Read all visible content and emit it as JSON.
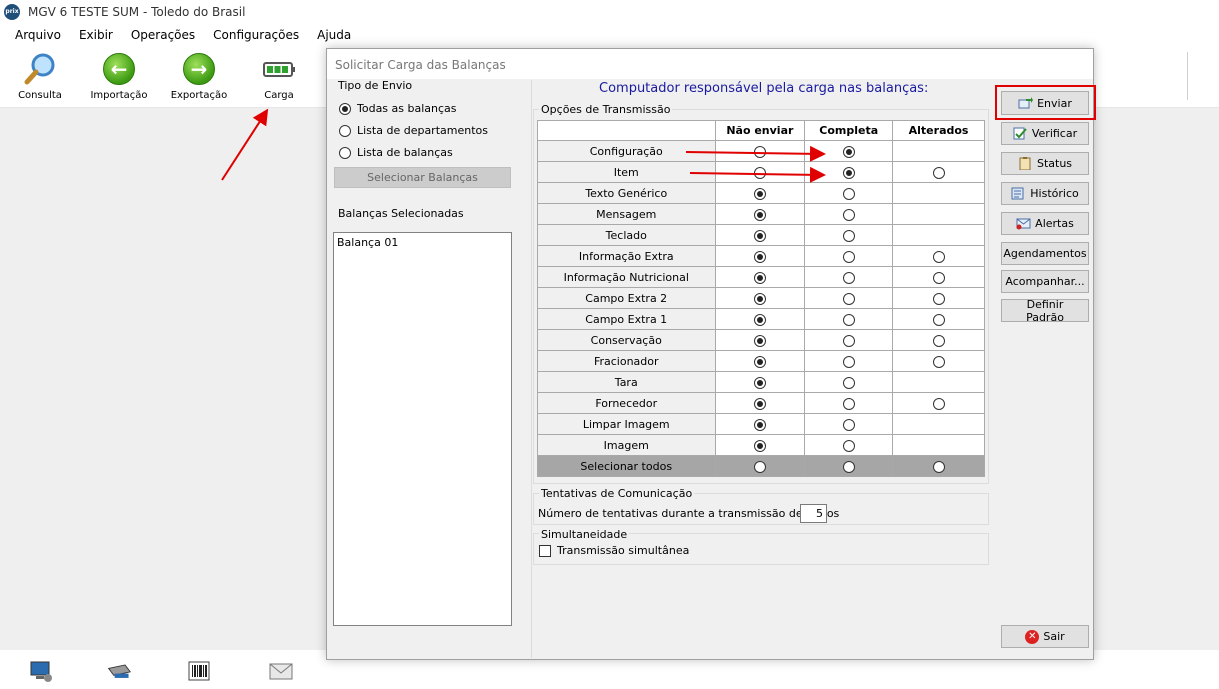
{
  "window": {
    "logo_text": "prix",
    "title": "MGV 6 TESTE SUM - Toledo do Brasil"
  },
  "menu": [
    {
      "label": "Arquivo"
    },
    {
      "label": "Exibir"
    },
    {
      "label": "Operações"
    },
    {
      "label": "Configurações"
    },
    {
      "label": "Ajuda"
    }
  ],
  "toolbar": {
    "consulta": "Consulta",
    "importacao": "Importação",
    "exportacao": "Exportação",
    "carga": "Carga"
  },
  "dialog": {
    "title": "Solicitar Carga das Balanças",
    "heading": "Computador responsável pela carga nas balanças:",
    "tipo_envio": {
      "label": "Tipo de Envio",
      "options": [
        "Todas as balanças",
        "Lista de departamentos",
        "Lista de balanças"
      ],
      "selected_index": 0,
      "select_button": "Selecionar Balanças"
    },
    "selected_scales": {
      "label": "Balanças Selecionadas",
      "items": [
        "Balança 01"
      ]
    },
    "options": {
      "label": "Opções de Transmissão",
      "headers": [
        "",
        "Não enviar",
        "Completa",
        "Alterados"
      ],
      "rows": [
        {
          "label": "Configuração",
          "selected": "completa",
          "has_alterados": false
        },
        {
          "label": "Item",
          "selected": "completa",
          "has_alterados": true
        },
        {
          "label": "Texto Genérico",
          "selected": "nao_enviar",
          "has_alterados": false
        },
        {
          "label": "Mensagem",
          "selected": "nao_enviar",
          "has_alterados": false
        },
        {
          "label": "Teclado",
          "selected": "nao_enviar",
          "has_alterados": false
        },
        {
          "label": "Informação Extra",
          "selected": "nao_enviar",
          "has_alterados": true
        },
        {
          "label": "Informação Nutricional",
          "selected": "nao_enviar",
          "has_alterados": true
        },
        {
          "label": "Campo Extra 2",
          "selected": "nao_enviar",
          "has_alterados": true
        },
        {
          "label": "Campo Extra 1",
          "selected": "nao_enviar",
          "has_alterados": true
        },
        {
          "label": "Conservação",
          "selected": "nao_enviar",
          "has_alterados": true
        },
        {
          "label": "Fracionador",
          "selected": "nao_enviar",
          "has_alterados": true
        },
        {
          "label": "Tara",
          "selected": "nao_enviar",
          "has_alterados": false
        },
        {
          "label": "Fornecedor",
          "selected": "nao_enviar",
          "has_alterados": true
        },
        {
          "label": "Limpar Imagem",
          "selected": "nao_enviar",
          "has_alterados": false
        },
        {
          "label": "Imagem",
          "selected": "nao_enviar",
          "has_alterados": false
        }
      ],
      "select_all_label": "Selecionar todos"
    },
    "tentativas": {
      "label": "Tentativas de Comunicação",
      "field_label": "Número de tentativas durante a transmissão de dados",
      "value": "5"
    },
    "simultaneidade": {
      "label": "Simultaneidade",
      "checkbox_label": "Transmissão simultânea",
      "checked": false
    },
    "buttons": {
      "enviar": "Enviar",
      "verificar": "Verificar",
      "status": "Status",
      "historico": "Histórico",
      "alertas": "Alertas",
      "agendamentos": "Agendamentos",
      "acompanhar": "Acompanhar...",
      "definir_padrao": "Definir Padrão",
      "sair": "Sair"
    }
  },
  "colors": {
    "heading_blue": "#1a1aa0",
    "annotation_red": "#e00000",
    "green_icon": "#3c9a12"
  },
  "taskbar_icons": [
    "computer-scale-icon",
    "scale-icon",
    "barcode-icon",
    "envelope-icon"
  ]
}
